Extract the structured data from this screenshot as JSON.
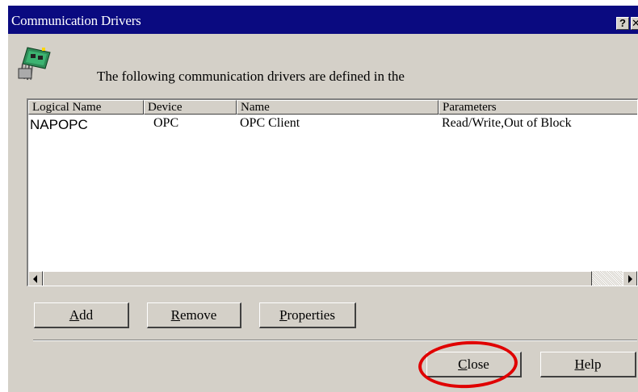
{
  "window": {
    "title": "Communication Drivers",
    "help_button": "?",
    "close_button": "✕"
  },
  "header": {
    "icon": "network-card-icon",
    "text": "The following communication drivers are defined in the"
  },
  "drivers_list": {
    "columns": [
      "Logical Name",
      "Device",
      "Name",
      "Parameters"
    ],
    "rows": [
      {
        "logical_name": "NAPOPC",
        "device": "OPC",
        "name": "OPC Client",
        "parameters": "Read/Write,Out of Block"
      }
    ]
  },
  "buttons": {
    "add": {
      "accel": "A",
      "rest": "dd"
    },
    "remove": {
      "accel": "R",
      "rest": "emove"
    },
    "properties": {
      "accel": "P",
      "rest": "roperties"
    },
    "close": {
      "accel": "C",
      "rest": "lose"
    },
    "help": {
      "accel": "H",
      "rest": "elp"
    }
  },
  "colors": {
    "titlebar": "#0a0a80",
    "dialog_face": "#d4d0c8",
    "annotation_ring": "#e00000"
  }
}
